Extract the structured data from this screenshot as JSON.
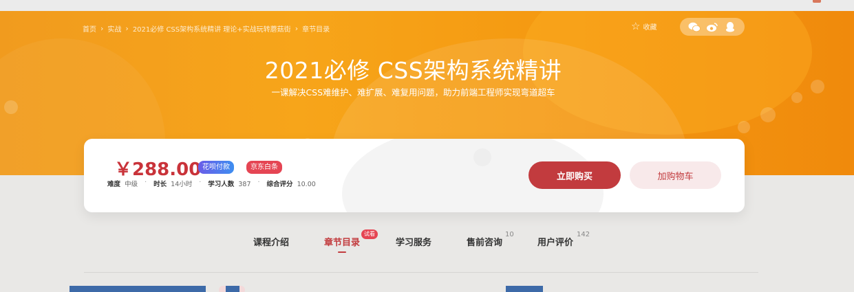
{
  "breadcrumb": {
    "items": [
      "首页",
      "实战",
      "2021必修 CSS架构系统精讲 理论+实战玩转蘑菇街",
      "章节目录"
    ]
  },
  "header": {
    "favorite_label": "收藏",
    "share_icons": [
      "wechat-icon",
      "weibo-icon",
      "qq-icon"
    ]
  },
  "course": {
    "title": "2021必修 CSS架构系统精讲",
    "subtitle": "一课解决CSS难维护、难扩展、难复用问题，助力前端工程师实现弯道超车"
  },
  "purchase": {
    "price": "￥288.00",
    "badge_huabei": "花呗付款",
    "badge_jd": "京东白条",
    "meta": [
      {
        "key": "难度",
        "value": "中级"
      },
      {
        "key": "时长",
        "value": "14小时"
      },
      {
        "key": "学习人数",
        "value": "387"
      },
      {
        "key": "综合评分",
        "value": "10.00"
      }
    ],
    "buy_label": "立即购买",
    "cart_label": "加购物车"
  },
  "tabs": {
    "items": [
      {
        "label": "课程介绍"
      },
      {
        "label": "章节目录",
        "badge": "试看"
      },
      {
        "label": "学习服务"
      },
      {
        "label": "售前咨询",
        "count": "10"
      },
      {
        "label": "用户评价",
        "count": "142"
      }
    ]
  },
  "colors": {
    "accent": "#c23b3e",
    "hero_orange": "#f59b12"
  }
}
